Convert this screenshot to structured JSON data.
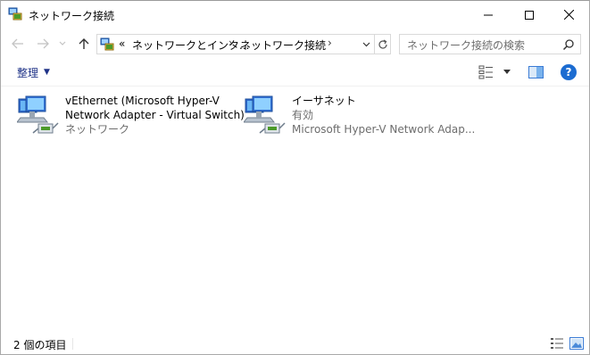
{
  "window": {
    "title": "ネットワーク接続",
    "icon": "network-connections-icon"
  },
  "navigation": {
    "back_icon": "arrow-left-icon",
    "forward_icon": "arrow-right-icon",
    "recent_icon": "chevron-down-icon",
    "up_icon": "arrow-up-icon",
    "address": {
      "overflow": "«",
      "segments": [
        "ネットワークとインタ...",
        "ネットワーク接続"
      ]
    },
    "search_placeholder": "ネットワーク接続の検索"
  },
  "command_bar": {
    "organize_label": "整理",
    "help_label": "?"
  },
  "connections": [
    {
      "name_line1": "vEthernet (Microsoft Hyper-V",
      "name_line2": "Network Adapter - Virtual Switch)",
      "status": "ネットワーク"
    },
    {
      "name_line1": "イーサネット",
      "name_line2": "有効",
      "status": "Microsoft Hyper-V Network Adap..."
    }
  ],
  "status_bar": {
    "item_count": "2 個の項目"
  },
  "colors": {
    "accent": "#1e3287",
    "help": "#1c6cd1",
    "secondary_text": "#6d6d6d"
  }
}
